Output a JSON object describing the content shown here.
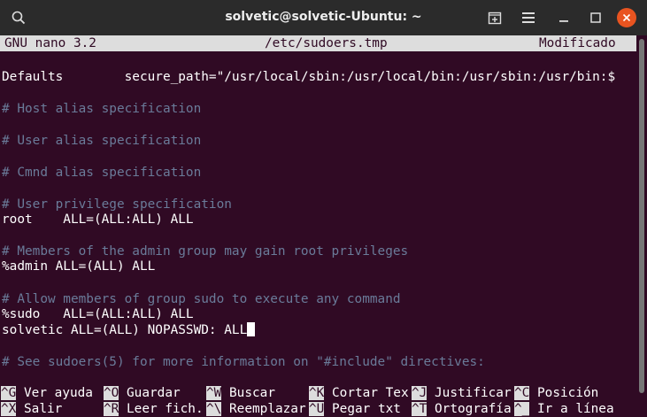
{
  "window": {
    "title": "solvetic@solvetic-Ubuntu: ~"
  },
  "nano": {
    "version": "GNU nano 3.2",
    "filename": "/etc/sudoers.tmp",
    "status": "Modificado"
  },
  "lines": {
    "defaults": "Defaults        secure_path=\"/usr/local/sbin:/usr/local/bin:/usr/sbin:/usr/bin:$",
    "host_alias": "# Host alias specification",
    "user_alias": "# User alias specification",
    "cmnd_alias": "# Cmnd alias specification",
    "user_priv": "# User privilege specification",
    "root": "root    ALL=(ALL:ALL) ALL",
    "admin_comment": "# Members of the admin group may gain root privileges",
    "admin": "%admin ALL=(ALL) ALL",
    "sudo_comment": "# Allow members of group sudo to execute any command",
    "sudo": "%sudo   ALL=(ALL:ALL) ALL",
    "solvetic": "solvetic ALL=(ALL) NOPASSWD: ALL",
    "include_comment": "# See sudoers(5) for more information on \"#include\" directives:"
  },
  "shortcuts": {
    "row1": [
      {
        "key": "^G",
        "label": "Ver ayuda"
      },
      {
        "key": "^O",
        "label": "Guardar"
      },
      {
        "key": "^W",
        "label": "Buscar"
      },
      {
        "key": "^K",
        "label": "Cortar Tex"
      },
      {
        "key": "^J",
        "label": "Justificar"
      },
      {
        "key": "^C",
        "label": "Posición"
      }
    ],
    "row2": [
      {
        "key": "^X",
        "label": "Salir"
      },
      {
        "key": "^R",
        "label": "Leer fich."
      },
      {
        "key": "^\\",
        "label": "Reemplazar"
      },
      {
        "key": "^U",
        "label": "Pegar txt"
      },
      {
        "key": "^T",
        "label": "Ortografía"
      },
      {
        "key": "^_",
        "label": "Ir a línea"
      }
    ]
  },
  "icons": {
    "search": "search-icon",
    "new_tab": "new-tab-icon",
    "menu": "hamburger-menu-icon",
    "minimize": "minimize-icon",
    "maximize": "maximize-icon",
    "close": "close-icon"
  },
  "colors": {
    "background": "#300a24",
    "comment": "#6a7b99",
    "close_button": "#e95420"
  }
}
